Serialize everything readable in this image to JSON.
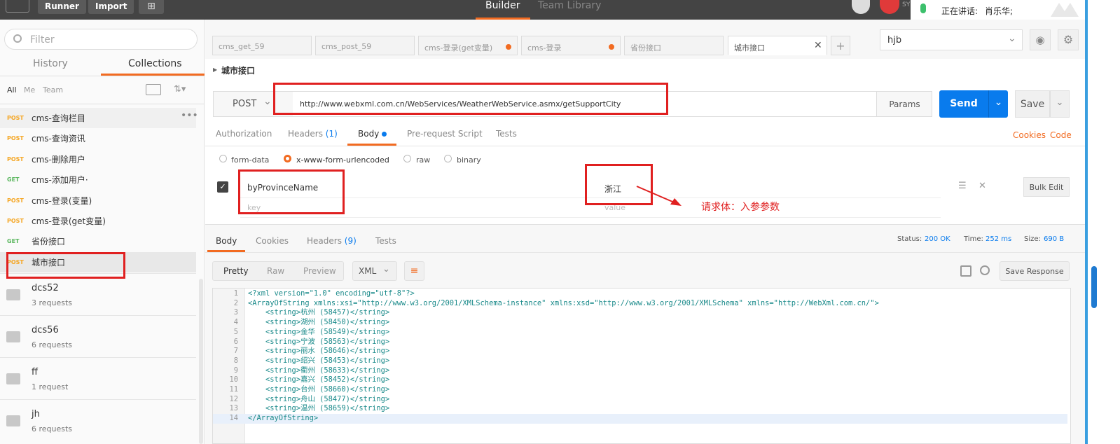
{
  "topbar": {
    "runner": "Runner",
    "import": "Import",
    "builder": "Builder",
    "team_library": "Team Library",
    "speaking_label": "正在讲话:",
    "speaker": "肖乐华;",
    "sync_label": "SY"
  },
  "sidebar": {
    "filter_placeholder": "Filter",
    "tabs": [
      "History",
      "Collections"
    ],
    "scopes": [
      "All",
      "Me",
      "Team"
    ],
    "requests": [
      {
        "method": "POST",
        "name": "cms-查询栏目",
        "color": "#f5a623"
      },
      {
        "method": "POST",
        "name": "cms-查询资讯",
        "color": "#f5a623"
      },
      {
        "method": "POST",
        "name": "cms-删除用户",
        "color": "#f5a623"
      },
      {
        "method": "GET",
        "name": "cms-添加用户·",
        "color": "#58b65c"
      },
      {
        "method": "POST",
        "name": "cms-登录(变量)",
        "color": "#f5a623"
      },
      {
        "method": "POST",
        "name": "cms-登录(get变量)",
        "color": "#f5a623"
      },
      {
        "method": "GET",
        "name": "省份接口",
        "color": "#58b65c"
      },
      {
        "method": "POST",
        "name": "城市接口",
        "color": "#f5a623"
      }
    ],
    "folders": [
      {
        "name": "dcs52",
        "count": "3 requests"
      },
      {
        "name": "dcs56",
        "count": "6 requests"
      },
      {
        "name": "ff",
        "count": "1 request"
      },
      {
        "name": "jh",
        "count": "6 requests"
      }
    ]
  },
  "tabs": [
    {
      "label": "cms_get_59"
    },
    {
      "label": "cms_post_59"
    },
    {
      "label": "cms-登录(get变量)"
    },
    {
      "label": "cms-登录"
    },
    {
      "label": "省份接口"
    },
    {
      "label": "城市接口"
    }
  ],
  "environment": "hjb",
  "request": {
    "title": "城市接口",
    "method": "POST",
    "url": "http://www.webxml.com.cn/WebServices/WeatherWebService.asmx/getSupportCity",
    "params": "Params",
    "send": "Send",
    "save": "Save"
  },
  "req_tabs": {
    "authorization": "Authorization",
    "headers": "Headers",
    "headers_count": "(1)",
    "body": "Body",
    "prerequest": "Pre-request Script",
    "tests": "Tests",
    "cookies": "Cookies",
    "code": "Code"
  },
  "body_types": [
    "form-data",
    "x-www-form-urlencoded",
    "raw",
    "binary"
  ],
  "params": {
    "key": "byProvinceName",
    "value": "浙江",
    "key_placeholder": "key",
    "value_placeholder": "value",
    "bulk_edit": "Bulk Edit"
  },
  "annotation": "请求体：入参参数",
  "response": {
    "tabs": {
      "body": "Body",
      "cookies": "Cookies",
      "headers": "Headers",
      "headers_count": "(9)",
      "tests": "Tests"
    },
    "status_label": "Status:",
    "status": "200 OK",
    "time_label": "Time:",
    "time": "252 ms",
    "size_label": "Size:",
    "size": "690 B",
    "view_modes": [
      "Pretty",
      "Raw",
      "Preview"
    ],
    "format": "XML",
    "save_response": "Save Response"
  },
  "code_lines": [
    {
      "n": "1",
      "text": "<?xml version=\"1.0\" encoding=\"utf-8\"?>"
    },
    {
      "n": "2",
      "text": "<ArrayOfString xmlns:xsi=\"http://www.w3.org/2001/XMLSchema-instance\" xmlns:xsd=\"http://www.w3.org/2001/XMLSchema\" xmlns=\"http://WebXml.com.cn/\">"
    },
    {
      "n": "3",
      "text": "    <string>杭州 (58457)</string>"
    },
    {
      "n": "4",
      "text": "    <string>湖州 (58450)</string>"
    },
    {
      "n": "5",
      "text": "    <string>金华 (58549)</string>"
    },
    {
      "n": "6",
      "text": "    <string>宁波 (58563)</string>"
    },
    {
      "n": "7",
      "text": "    <string>丽水 (58646)</string>"
    },
    {
      "n": "8",
      "text": "    <string>绍兴 (58453)</string>"
    },
    {
      "n": "9",
      "text": "    <string>衢州 (58633)</string>"
    },
    {
      "n": "10",
      "text": "    <string>嘉兴 (58452)</string>"
    },
    {
      "n": "11",
      "text": "    <string>台州 (58660)</string>"
    },
    {
      "n": "12",
      "text": "    <string>舟山 (58477)</string>"
    },
    {
      "n": "13",
      "text": "    <string>温州 (58659)</string>"
    },
    {
      "n": "14",
      "text": "</ArrayOfString>"
    }
  ],
  "colors": {
    "accent": "#f26b21",
    "send_blue": "#097bed",
    "tag_teal": "#1a8a8a",
    "annotation_red": "#e02020"
  }
}
